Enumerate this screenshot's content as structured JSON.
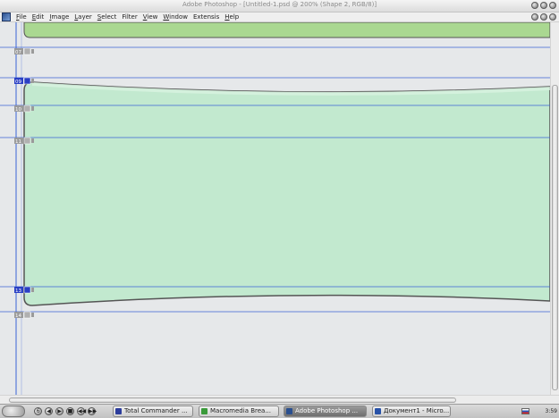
{
  "window": {
    "title": "Adobe Photoshop - [Untitled-1.psd @ 200% (Shape 2, RGB/8)]"
  },
  "menu": [
    {
      "key": "F",
      "rest": "ile"
    },
    {
      "key": "E",
      "rest": "dit"
    },
    {
      "key": "I",
      "rest": "mage"
    },
    {
      "key": "L",
      "rest": "ayer"
    },
    {
      "key": "S",
      "rest": "elect"
    },
    {
      "key": "",
      "rest": "Filter"
    },
    {
      "key": "V",
      "rest": "iew"
    },
    {
      "key": "W",
      "rest": "indow"
    },
    {
      "key": "",
      "rest": "Extensis"
    },
    {
      "key": "H",
      "rest": "elp"
    }
  ],
  "slices": [
    {
      "id": "07",
      "active": false
    },
    {
      "id": "09",
      "active": true
    },
    {
      "id": "10",
      "active": false
    },
    {
      "id": "11",
      "active": false
    },
    {
      "id": "13",
      "active": true
    },
    {
      "id": "14",
      "active": false
    }
  ],
  "colors": {
    "guide": "#3a63d6",
    "shape_fill": "#c2e9cf",
    "top_shape_fill": "#aad891",
    "outline": "#555555"
  },
  "taskbar": {
    "quick_launch": [
      "6",
      "◀",
      "▶",
      "■",
      "◀◀",
      "▶▶"
    ],
    "tasks": [
      {
        "label": "Total Commander ...",
        "active": false,
        "icon_color": "#2c3d9c"
      },
      {
        "label": "Macromedia Brea...",
        "active": false,
        "icon_color": "#3a9a3a"
      },
      {
        "label": "Adobe Photoshop ...",
        "active": true,
        "icon_color": "#2a4f8f"
      },
      {
        "label": "Документ1 - Micro...",
        "active": false,
        "icon_color": "#2852a8"
      }
    ],
    "clock": "3:59"
  }
}
